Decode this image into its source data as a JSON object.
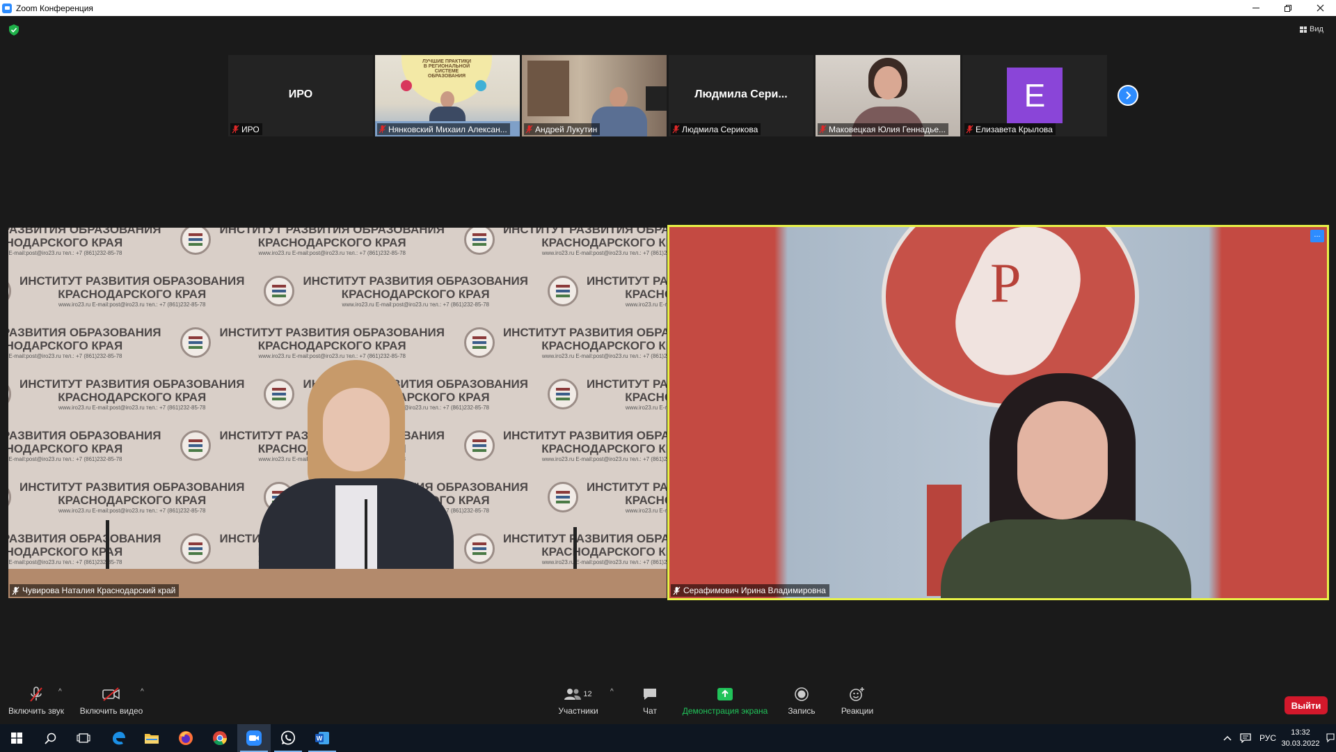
{
  "window": {
    "title": "Zoom Конференция"
  },
  "topbar": {
    "view_label": "Вид"
  },
  "thumbnails": [
    {
      "big_name": "ИРО",
      "name": "ИРО",
      "muted": true,
      "has_video": false
    },
    {
      "name": "Нянковский Михаил Алексан...",
      "muted": true,
      "has_video": true,
      "video_desc": "speaker-with-best-practices-poster"
    },
    {
      "name": "Андрей Лукутин",
      "muted": true,
      "has_video": true,
      "video_desc": "man-in-room"
    },
    {
      "big_name": "Людмила  Сери...",
      "name": "Людмила Серикова",
      "muted": true,
      "has_video": false
    },
    {
      "name": "Маковецкая Юлия Геннадье...",
      "muted": true,
      "has_video": true,
      "video_desc": "woman-with-glasses"
    },
    {
      "avatar_letter": "E",
      "name": "Елизавета Крылова",
      "muted": true,
      "has_video": false
    }
  ],
  "thumb_poster": {
    "lines": [
      "ЛУЧШИЕ ПРАКТИКИ",
      "В РЕГИОНАЛЬНОЙ",
      "СИСТЕМЕ",
      "ОБРАЗОВАНИЯ"
    ]
  },
  "main_tiles": [
    {
      "name": "Чувирова Наталия Краснодарский край",
      "muted": true,
      "backdrop_title_1": "ИНСТИТУТ РАЗВИТИЯ ОБРАЗОВАНИЯ",
      "backdrop_title_2": "КРАСНОДАРСКОГО КРАЯ",
      "backdrop_contacts": "www.iro23.ru  E-mail:post@iro23.ru  тел.: +7 (861)232-85-78"
    },
    {
      "name": "Серафимович Ирина Владимировна",
      "muted": true,
      "active_speaker": true,
      "more_label": "..."
    }
  ],
  "toolbar": {
    "unmute_label": "Включить звук",
    "start_video_label": "Включить видео",
    "participants_label": "Участники",
    "participants_count": "12",
    "chat_label": "Чат",
    "share_label": "Демонстрация экрана",
    "record_label": "Запись",
    "reactions_label": "Реакции",
    "leave_label": "Выйти"
  },
  "taskbar": {
    "apps": [
      "start-icon",
      "search-icon",
      "task-view-icon",
      "edge-icon",
      "file-explorer-icon",
      "firefox-icon",
      "chrome-icon",
      "zoom-icon",
      "whatsapp-icon",
      "word-icon"
    ],
    "language": "РУС",
    "time": "13:32",
    "date": "30.03.2022"
  },
  "colors": {
    "zoom_blue": "#2d8cff",
    "active_speaker_border": "#e8f248",
    "leave_red": "#d3182b",
    "share_green": "#21c35a",
    "muted_red": "#e02828",
    "avatar_purple": "#8a45d8"
  }
}
